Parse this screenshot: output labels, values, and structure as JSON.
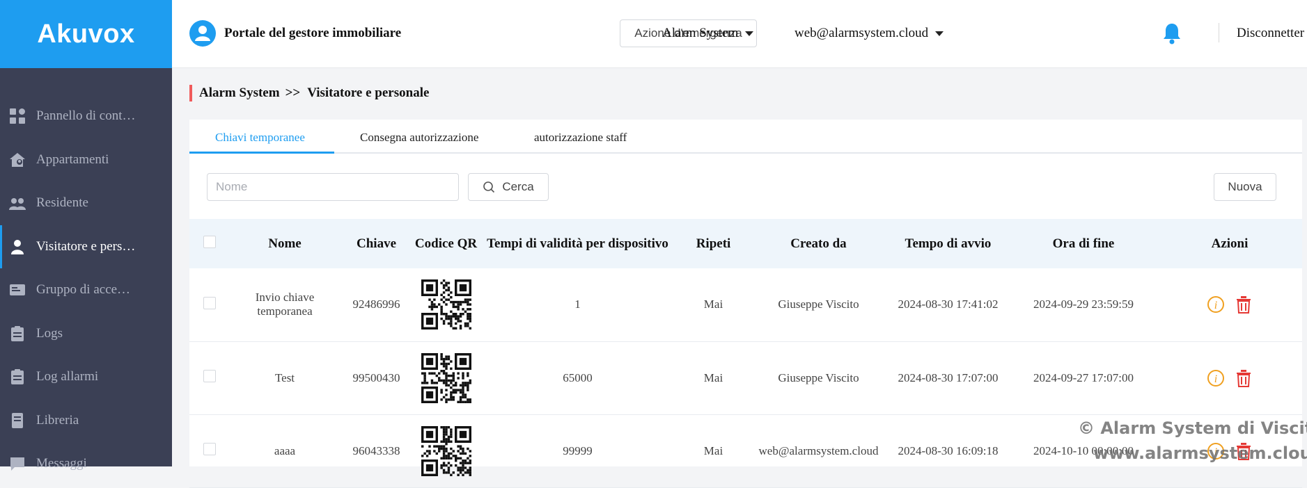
{
  "brand": {
    "logo_text": "Akuvox",
    "accent": "#1e9df0",
    "sidebar_bg": "#3b4055"
  },
  "header": {
    "portal_title": "Portale del gestore immobiliare",
    "emergency_label": "Azione d'emergenza",
    "site_selector": "Alarm System",
    "account_selector": "web@alarmsystem.cloud",
    "logout_label": "Disconnetter"
  },
  "sidebar": {
    "items": [
      {
        "label": "Pannello di cont…",
        "icon": "dashboard-icon",
        "active": false
      },
      {
        "label": "Appartamenti",
        "icon": "apartment-icon",
        "active": false
      },
      {
        "label": "Residente",
        "icon": "residents-icon",
        "active": false
      },
      {
        "label": "Visitatore e pers…",
        "icon": "visitor-icon",
        "active": true
      },
      {
        "label": "Gruppo di acce…",
        "icon": "access-card-icon",
        "active": false
      },
      {
        "label": "Logs",
        "icon": "clipboard-icon",
        "active": false
      },
      {
        "label": "Log allarmi",
        "icon": "alarm-log-icon",
        "active": false
      },
      {
        "label": "Libreria",
        "icon": "library-icon",
        "active": false
      },
      {
        "label": "Messaggi",
        "icon": "message-icon",
        "active": false
      }
    ]
  },
  "breadcrumb": {
    "parent": "Alarm System",
    "separator": ">>",
    "current": "Visitatore e personale"
  },
  "tabs": [
    {
      "label": "Chiavi temporanee",
      "active": true
    },
    {
      "label": "Consegna autorizzazione",
      "active": false
    },
    {
      "label": "autorizzazione staff",
      "active": false
    }
  ],
  "toolbar": {
    "search_placeholder": "Nome",
    "search_value": "",
    "search_label": "Cerca",
    "new_label": "Nuova"
  },
  "table": {
    "columns": [
      "Nome",
      "Chiave",
      "Codice QR",
      "Tempi di validità per dispositivo",
      "Ripeti",
      "Creato da",
      "Tempo di avvio",
      "Ora di fine",
      "Azioni"
    ],
    "rows": [
      {
        "nome": "Invio chiave temporanea",
        "chiave": "92486996",
        "tempi": "1",
        "ripeti": "Mai",
        "creato_da": "Giuseppe Viscito",
        "avvio": "2024-08-30 17:41:02",
        "fine": "2024-09-29 23:59:59"
      },
      {
        "nome": "Test",
        "chiave": "99500430",
        "tempi": "65000",
        "ripeti": "Mai",
        "creato_da": "Giuseppe Viscito",
        "avvio": "2024-08-30 17:07:00",
        "fine": "2024-09-27 17:07:00"
      },
      {
        "nome": "aaaa",
        "chiave": "96043338",
        "tempi": "99999",
        "ripeti": "Mai",
        "creato_da": "web@alarmsystem.cloud",
        "avvio": "2024-08-30 16:09:18",
        "fine": "2024-10-10 00:00:00"
      }
    ]
  },
  "watermark": {
    "line1": "© Alarm System di Viscito G.",
    "line2": "www.alarmsystem.cloud"
  }
}
